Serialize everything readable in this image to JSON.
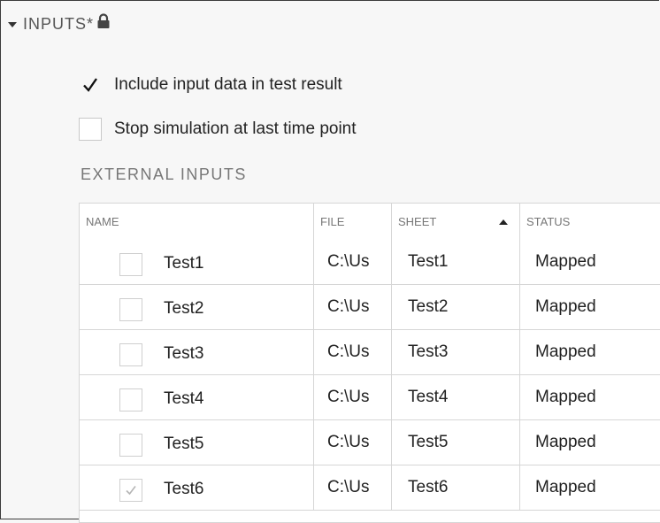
{
  "section": {
    "title": "INPUTS*",
    "icon": "lock-icon"
  },
  "options": [
    {
      "label": "Include input data in test result",
      "checked": true
    },
    {
      "label": "Stop simulation at last time point",
      "checked": false
    }
  ],
  "external_inputs": {
    "title": "EXTERNAL INPUTS",
    "columns": [
      "NAME",
      "FILE",
      "SHEET",
      "STATUS"
    ],
    "sort_column": "SHEET",
    "sort_direction": "ascending",
    "rows": [
      {
        "name": "Test1",
        "file": "C:\\Us",
        "sheet": "Test1",
        "status": "Mapped",
        "checked": false
      },
      {
        "name": "Test2",
        "file": "C:\\Us",
        "sheet": "Test2",
        "status": "Mapped",
        "checked": false
      },
      {
        "name": "Test3",
        "file": "C:\\Us",
        "sheet": "Test3",
        "status": "Mapped",
        "checked": false
      },
      {
        "name": "Test4",
        "file": "C:\\Us",
        "sheet": "Test4",
        "status": "Mapped",
        "checked": false
      },
      {
        "name": "Test5",
        "file": "C:\\Us",
        "sheet": "Test5",
        "status": "Mapped",
        "checked": false
      },
      {
        "name": "Test6",
        "file": "C:\\Us",
        "sheet": "Test6",
        "status": "Mapped",
        "checked": true
      }
    ]
  }
}
